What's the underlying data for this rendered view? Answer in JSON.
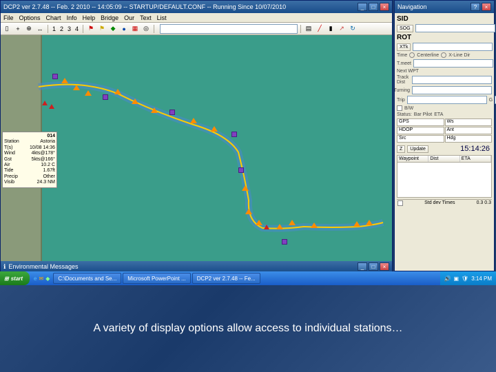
{
  "main_window": {
    "title": "DCP2 ver 2.7.48 -- Feb. 2 2010 -- 14:05:09 -- STARTUP/DEFAULT.CONF -- Running Since 10/07/2010",
    "menus": [
      "File",
      "Options",
      "Chart",
      "Info",
      "Help",
      "Bridge",
      "Our",
      "Text",
      "List"
    ],
    "toolbar_numbers": [
      "1",
      "2",
      "3",
      "4"
    ]
  },
  "info_box": {
    "title": "014",
    "rows": [
      {
        "k": "Station",
        "v": "Astoria"
      },
      {
        "k": "T(s)",
        "v": "10/08 14:36"
      },
      {
        "k": "Wind",
        "v": "4kts@178°"
      },
      {
        "k": "Gst",
        "v": "5kts@166°"
      },
      {
        "k": "Air",
        "v": "10.2 C"
      },
      {
        "k": "Tide",
        "v": "1.67ft"
      },
      {
        "k": "Precip",
        "v": "Other"
      },
      {
        "k": "Visib",
        "v": "24.3 NM"
      }
    ]
  },
  "msg_bar": {
    "text": "Environmental Messages"
  },
  "nav_panel": {
    "title": "Navigation",
    "sid_label": "SID",
    "sog_btn": "SOG",
    "rot_label": "ROT",
    "xtk_btn": "XTk",
    "time_label": "Time",
    "center_opt": "Centerline",
    "xline_opt": "X-Line Dir",
    "tmeet_label": "T.meet",
    "next_wpt_label": "Next WPT",
    "track_dist_label": "Track Dist",
    "turning_label": "Turning",
    "trip_label": "Trip",
    "g_label": "G",
    "bw_label": "B/W",
    "status_label": "Status:",
    "bar_pilot": "Bar Pilot",
    "eta_label": "ETA",
    "grid_cells": [
      "GPS",
      "Ws",
      "HDOP",
      "Ant",
      "Src",
      "Hdg"
    ],
    "update_btn": "Update",
    "clock": "15:14:26",
    "list_cols": [
      "Waypoint",
      "Dist",
      "ETA"
    ],
    "status_left": "Std dev Times",
    "status_right": "0.3 0.3"
  },
  "taskbar": {
    "start": "start",
    "tasks": [
      "C:\\Documents and Se...",
      "Microsoft PowerPoint ...",
      "DCP2 ver 2.7.48 -- Fe..."
    ],
    "tray_time": "3:14 PM"
  },
  "caption": "A variety of display options allow access to individual stations…"
}
